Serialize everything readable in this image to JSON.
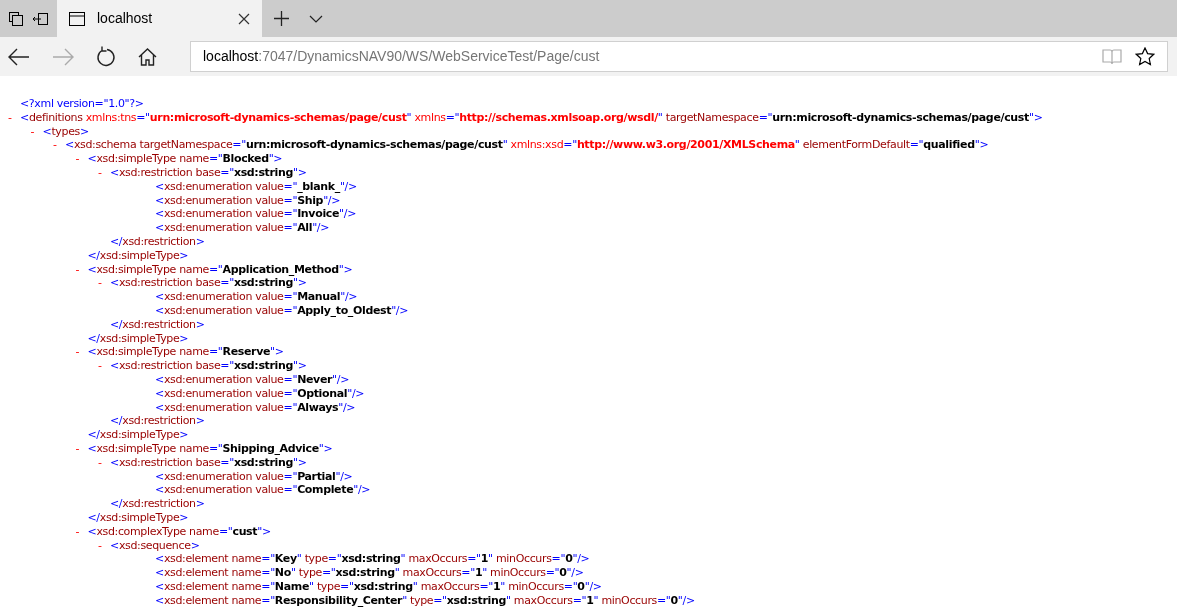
{
  "tab": {
    "title": "localhost",
    "selected": true
  },
  "address": {
    "host": "localhost",
    "path": ":7047/DynamicsNAV90/WS/WebServiceTest/Page/cust"
  },
  "nav": {
    "back_disabled": false,
    "forward_disabled": true
  },
  "xml": [
    {
      "parts": [
        {
          "kind": "markup",
          "text": "<?xml version=\"1.0\"?>"
        }
      ]
    },
    {
      "toggle": "-",
      "parts": [
        {
          "kind": "markup",
          "text": "<"
        },
        {
          "kind": "name",
          "text": "definitions"
        },
        {
          "kind": "nsname",
          "text": " xmlns:tns"
        },
        {
          "kind": "markup",
          "text": "=\""
        },
        {
          "kind": "nsvalue",
          "text": "urn:microsoft-dynamics-schemas/page/cust"
        },
        {
          "kind": "markup",
          "text": "\""
        },
        {
          "kind": "nsname",
          "text": " xmlns"
        },
        {
          "kind": "markup",
          "text": "=\""
        },
        {
          "kind": "nsvalue",
          "text": "http://schemas.xmlsoap.org/wsdl/"
        },
        {
          "kind": "markup",
          "text": "\""
        },
        {
          "kind": "name",
          "text": " targetNamespace"
        },
        {
          "kind": "markup",
          "text": "=\""
        },
        {
          "kind": "value",
          "text": "urn:microsoft-dynamics-schemas/page/cust"
        },
        {
          "kind": "markup",
          "text": "\">"
        }
      ],
      "children": [
        {
          "toggle": "-",
          "parts": [
            {
              "kind": "markup",
              "text": "<"
            },
            {
              "kind": "name",
              "text": "types"
            },
            {
              "kind": "markup",
              "text": ">"
            }
          ],
          "children": [
            {
              "toggle": "-",
              "parts": [
                {
                  "kind": "markup",
                  "text": "<"
                },
                {
                  "kind": "name",
                  "text": "xsd:schema"
                },
                {
                  "kind": "name",
                  "text": " targetNamespace"
                },
                {
                  "kind": "markup",
                  "text": "=\""
                },
                {
                  "kind": "value",
                  "text": "urn:microsoft-dynamics-schemas/page/cust"
                },
                {
                  "kind": "markup",
                  "text": "\""
                },
                {
                  "kind": "nsname",
                  "text": " xmlns:xsd"
                },
                {
                  "kind": "markup",
                  "text": "=\""
                },
                {
                  "kind": "nsvalue",
                  "text": "http://www.w3.org/2001/XMLSchema"
                },
                {
                  "kind": "markup",
                  "text": "\""
                },
                {
                  "kind": "name",
                  "text": " elementFormDefault"
                },
                {
                  "kind": "markup",
                  "text": "=\""
                },
                {
                  "kind": "value",
                  "text": "qualified"
                },
                {
                  "kind": "markup",
                  "text": "\">"
                }
              ],
              "children": [
                {
                  "toggle": "-",
                  "parts": [
                    {
                      "kind": "markup",
                      "text": "<"
                    },
                    {
                      "kind": "name",
                      "text": "xsd:simpleType"
                    },
                    {
                      "kind": "name",
                      "text": " name"
                    },
                    {
                      "kind": "markup",
                      "text": "=\""
                    },
                    {
                      "kind": "value",
                      "text": "Blocked"
                    },
                    {
                      "kind": "markup",
                      "text": "\">"
                    }
                  ],
                  "children": [
                    {
                      "toggle": "-",
                      "parts": [
                        {
                          "kind": "markup",
                          "text": "<"
                        },
                        {
                          "kind": "name",
                          "text": "xsd:restriction"
                        },
                        {
                          "kind": "name",
                          "text": " base"
                        },
                        {
                          "kind": "markup",
                          "text": "=\""
                        },
                        {
                          "kind": "value",
                          "text": "xsd:string"
                        },
                        {
                          "kind": "markup",
                          "text": "\">"
                        }
                      ],
                      "children": [
                        {
                          "parts": [
                            {
                              "kind": "markup",
                              "text": "<"
                            },
                            {
                              "kind": "name",
                              "text": "xsd:enumeration"
                            },
                            {
                              "kind": "name",
                              "text": " value"
                            },
                            {
                              "kind": "markup",
                              "text": "=\""
                            },
                            {
                              "kind": "value",
                              "text": "_blank_"
                            },
                            {
                              "kind": "markup",
                              "text": "\"/>"
                            }
                          ]
                        },
                        {
                          "parts": [
                            {
                              "kind": "markup",
                              "text": "<"
                            },
                            {
                              "kind": "name",
                              "text": "xsd:enumeration"
                            },
                            {
                              "kind": "name",
                              "text": " value"
                            },
                            {
                              "kind": "markup",
                              "text": "=\""
                            },
                            {
                              "kind": "value",
                              "text": "Ship"
                            },
                            {
                              "kind": "markup",
                              "text": "\"/>"
                            }
                          ]
                        },
                        {
                          "parts": [
                            {
                              "kind": "markup",
                              "text": "<"
                            },
                            {
                              "kind": "name",
                              "text": "xsd:enumeration"
                            },
                            {
                              "kind": "name",
                              "text": " value"
                            },
                            {
                              "kind": "markup",
                              "text": "=\""
                            },
                            {
                              "kind": "value",
                              "text": "Invoice"
                            },
                            {
                              "kind": "markup",
                              "text": "\"/>"
                            }
                          ]
                        },
                        {
                          "parts": [
                            {
                              "kind": "markup",
                              "text": "<"
                            },
                            {
                              "kind": "name",
                              "text": "xsd:enumeration"
                            },
                            {
                              "kind": "name",
                              "text": " value"
                            },
                            {
                              "kind": "markup",
                              "text": "=\""
                            },
                            {
                              "kind": "value",
                              "text": "All"
                            },
                            {
                              "kind": "markup",
                              "text": "\"/>"
                            }
                          ]
                        }
                      ],
                      "close": [
                        {
                          "kind": "markup",
                          "text": "</"
                        },
                        {
                          "kind": "name",
                          "text": "xsd:restriction"
                        },
                        {
                          "kind": "markup",
                          "text": ">"
                        }
                      ]
                    }
                  ],
                  "close": [
                    {
                      "kind": "markup",
                      "text": "</"
                    },
                    {
                      "kind": "name",
                      "text": "xsd:simpleType"
                    },
                    {
                      "kind": "markup",
                      "text": ">"
                    }
                  ]
                },
                {
                  "toggle": "-",
                  "parts": [
                    {
                      "kind": "markup",
                      "text": "<"
                    },
                    {
                      "kind": "name",
                      "text": "xsd:simpleType"
                    },
                    {
                      "kind": "name",
                      "text": " name"
                    },
                    {
                      "kind": "markup",
                      "text": "=\""
                    },
                    {
                      "kind": "value",
                      "text": "Application_Method"
                    },
                    {
                      "kind": "markup",
                      "text": "\">"
                    }
                  ],
                  "children": [
                    {
                      "toggle": "-",
                      "parts": [
                        {
                          "kind": "markup",
                          "text": "<"
                        },
                        {
                          "kind": "name",
                          "text": "xsd:restriction"
                        },
                        {
                          "kind": "name",
                          "text": " base"
                        },
                        {
                          "kind": "markup",
                          "text": "=\""
                        },
                        {
                          "kind": "value",
                          "text": "xsd:string"
                        },
                        {
                          "kind": "markup",
                          "text": "\">"
                        }
                      ],
                      "children": [
                        {
                          "parts": [
                            {
                              "kind": "markup",
                              "text": "<"
                            },
                            {
                              "kind": "name",
                              "text": "xsd:enumeration"
                            },
                            {
                              "kind": "name",
                              "text": " value"
                            },
                            {
                              "kind": "markup",
                              "text": "=\""
                            },
                            {
                              "kind": "value",
                              "text": "Manual"
                            },
                            {
                              "kind": "markup",
                              "text": "\"/>"
                            }
                          ]
                        },
                        {
                          "parts": [
                            {
                              "kind": "markup",
                              "text": "<"
                            },
                            {
                              "kind": "name",
                              "text": "xsd:enumeration"
                            },
                            {
                              "kind": "name",
                              "text": " value"
                            },
                            {
                              "kind": "markup",
                              "text": "=\""
                            },
                            {
                              "kind": "value",
                              "text": "Apply_to_Oldest"
                            },
                            {
                              "kind": "markup",
                              "text": "\"/>"
                            }
                          ]
                        }
                      ],
                      "close": [
                        {
                          "kind": "markup",
                          "text": "</"
                        },
                        {
                          "kind": "name",
                          "text": "xsd:restriction"
                        },
                        {
                          "kind": "markup",
                          "text": ">"
                        }
                      ]
                    }
                  ],
                  "close": [
                    {
                      "kind": "markup",
                      "text": "</"
                    },
                    {
                      "kind": "name",
                      "text": "xsd:simpleType"
                    },
                    {
                      "kind": "markup",
                      "text": ">"
                    }
                  ]
                },
                {
                  "toggle": "-",
                  "parts": [
                    {
                      "kind": "markup",
                      "text": "<"
                    },
                    {
                      "kind": "name",
                      "text": "xsd:simpleType"
                    },
                    {
                      "kind": "name",
                      "text": " name"
                    },
                    {
                      "kind": "markup",
                      "text": "=\""
                    },
                    {
                      "kind": "value",
                      "text": "Reserve"
                    },
                    {
                      "kind": "markup",
                      "text": "\">"
                    }
                  ],
                  "children": [
                    {
                      "toggle": "-",
                      "parts": [
                        {
                          "kind": "markup",
                          "text": "<"
                        },
                        {
                          "kind": "name",
                          "text": "xsd:restriction"
                        },
                        {
                          "kind": "name",
                          "text": " base"
                        },
                        {
                          "kind": "markup",
                          "text": "=\""
                        },
                        {
                          "kind": "value",
                          "text": "xsd:string"
                        },
                        {
                          "kind": "markup",
                          "text": "\">"
                        }
                      ],
                      "children": [
                        {
                          "parts": [
                            {
                              "kind": "markup",
                              "text": "<"
                            },
                            {
                              "kind": "name",
                              "text": "xsd:enumeration"
                            },
                            {
                              "kind": "name",
                              "text": " value"
                            },
                            {
                              "kind": "markup",
                              "text": "=\""
                            },
                            {
                              "kind": "value",
                              "text": "Never"
                            },
                            {
                              "kind": "markup",
                              "text": "\"/>"
                            }
                          ]
                        },
                        {
                          "parts": [
                            {
                              "kind": "markup",
                              "text": "<"
                            },
                            {
                              "kind": "name",
                              "text": "xsd:enumeration"
                            },
                            {
                              "kind": "name",
                              "text": " value"
                            },
                            {
                              "kind": "markup",
                              "text": "=\""
                            },
                            {
                              "kind": "value",
                              "text": "Optional"
                            },
                            {
                              "kind": "markup",
                              "text": "\"/>"
                            }
                          ]
                        },
                        {
                          "parts": [
                            {
                              "kind": "markup",
                              "text": "<"
                            },
                            {
                              "kind": "name",
                              "text": "xsd:enumeration"
                            },
                            {
                              "kind": "name",
                              "text": " value"
                            },
                            {
                              "kind": "markup",
                              "text": "=\""
                            },
                            {
                              "kind": "value",
                              "text": "Always"
                            },
                            {
                              "kind": "markup",
                              "text": "\"/>"
                            }
                          ]
                        }
                      ],
                      "close": [
                        {
                          "kind": "markup",
                          "text": "</"
                        },
                        {
                          "kind": "name",
                          "text": "xsd:restriction"
                        },
                        {
                          "kind": "markup",
                          "text": ">"
                        }
                      ]
                    }
                  ],
                  "close": [
                    {
                      "kind": "markup",
                      "text": "</"
                    },
                    {
                      "kind": "name",
                      "text": "xsd:simpleType"
                    },
                    {
                      "kind": "markup",
                      "text": ">"
                    }
                  ]
                },
                {
                  "toggle": "-",
                  "parts": [
                    {
                      "kind": "markup",
                      "text": "<"
                    },
                    {
                      "kind": "name",
                      "text": "xsd:simpleType"
                    },
                    {
                      "kind": "name",
                      "text": " name"
                    },
                    {
                      "kind": "markup",
                      "text": "=\""
                    },
                    {
                      "kind": "value",
                      "text": "Shipping_Advice"
                    },
                    {
                      "kind": "markup",
                      "text": "\">"
                    }
                  ],
                  "children": [
                    {
                      "toggle": "-",
                      "parts": [
                        {
                          "kind": "markup",
                          "text": "<"
                        },
                        {
                          "kind": "name",
                          "text": "xsd:restriction"
                        },
                        {
                          "kind": "name",
                          "text": " base"
                        },
                        {
                          "kind": "markup",
                          "text": "=\""
                        },
                        {
                          "kind": "value",
                          "text": "xsd:string"
                        },
                        {
                          "kind": "markup",
                          "text": "\">"
                        }
                      ],
                      "children": [
                        {
                          "parts": [
                            {
                              "kind": "markup",
                              "text": "<"
                            },
                            {
                              "kind": "name",
                              "text": "xsd:enumeration"
                            },
                            {
                              "kind": "name",
                              "text": " value"
                            },
                            {
                              "kind": "markup",
                              "text": "=\""
                            },
                            {
                              "kind": "value",
                              "text": "Partial"
                            },
                            {
                              "kind": "markup",
                              "text": "\"/>"
                            }
                          ]
                        },
                        {
                          "parts": [
                            {
                              "kind": "markup",
                              "text": "<"
                            },
                            {
                              "kind": "name",
                              "text": "xsd:enumeration"
                            },
                            {
                              "kind": "name",
                              "text": " value"
                            },
                            {
                              "kind": "markup",
                              "text": "=\""
                            },
                            {
                              "kind": "value",
                              "text": "Complete"
                            },
                            {
                              "kind": "markup",
                              "text": "\"/>"
                            }
                          ]
                        }
                      ],
                      "close": [
                        {
                          "kind": "markup",
                          "text": "</"
                        },
                        {
                          "kind": "name",
                          "text": "xsd:restriction"
                        },
                        {
                          "kind": "markup",
                          "text": ">"
                        }
                      ]
                    }
                  ],
                  "close": [
                    {
                      "kind": "markup",
                      "text": "</"
                    },
                    {
                      "kind": "name",
                      "text": "xsd:simpleType"
                    },
                    {
                      "kind": "markup",
                      "text": ">"
                    }
                  ]
                },
                {
                  "toggle": "-",
                  "parts": [
                    {
                      "kind": "markup",
                      "text": "<"
                    },
                    {
                      "kind": "name",
                      "text": "xsd:complexType"
                    },
                    {
                      "kind": "name",
                      "text": " name"
                    },
                    {
                      "kind": "markup",
                      "text": "=\""
                    },
                    {
                      "kind": "value",
                      "text": "cust"
                    },
                    {
                      "kind": "markup",
                      "text": "\">"
                    }
                  ],
                  "children": [
                    {
                      "toggle": "-",
                      "parts": [
                        {
                          "kind": "markup",
                          "text": "<"
                        },
                        {
                          "kind": "name",
                          "text": "xsd:sequence"
                        },
                        {
                          "kind": "markup",
                          "text": ">"
                        }
                      ],
                      "children": [
                        {
                          "parts": [
                            {
                              "kind": "markup",
                              "text": "<"
                            },
                            {
                              "kind": "name",
                              "text": "xsd:element"
                            },
                            {
                              "kind": "name",
                              "text": " name"
                            },
                            {
                              "kind": "markup",
                              "text": "=\""
                            },
                            {
                              "kind": "value",
                              "text": "Key"
                            },
                            {
                              "kind": "markup",
                              "text": "\""
                            },
                            {
                              "kind": "name",
                              "text": " type"
                            },
                            {
                              "kind": "markup",
                              "text": "=\""
                            },
                            {
                              "kind": "value",
                              "text": "xsd:string"
                            },
                            {
                              "kind": "markup",
                              "text": "\""
                            },
                            {
                              "kind": "name",
                              "text": " maxOccurs"
                            },
                            {
                              "kind": "markup",
                              "text": "=\""
                            },
                            {
                              "kind": "value",
                              "text": "1"
                            },
                            {
                              "kind": "markup",
                              "text": "\""
                            },
                            {
                              "kind": "name",
                              "text": " minOccurs"
                            },
                            {
                              "kind": "markup",
                              "text": "=\""
                            },
                            {
                              "kind": "value",
                              "text": "0"
                            },
                            {
                              "kind": "markup",
                              "text": "\"/>"
                            }
                          ]
                        },
                        {
                          "parts": [
                            {
                              "kind": "markup",
                              "text": "<"
                            },
                            {
                              "kind": "name",
                              "text": "xsd:element"
                            },
                            {
                              "kind": "name",
                              "text": " name"
                            },
                            {
                              "kind": "markup",
                              "text": "=\""
                            },
                            {
                              "kind": "value",
                              "text": "No"
                            },
                            {
                              "kind": "markup",
                              "text": "\""
                            },
                            {
                              "kind": "name",
                              "text": " type"
                            },
                            {
                              "kind": "markup",
                              "text": "=\""
                            },
                            {
                              "kind": "value",
                              "text": "xsd:string"
                            },
                            {
                              "kind": "markup",
                              "text": "\""
                            },
                            {
                              "kind": "name",
                              "text": " maxOccurs"
                            },
                            {
                              "kind": "markup",
                              "text": "=\""
                            },
                            {
                              "kind": "value",
                              "text": "1"
                            },
                            {
                              "kind": "markup",
                              "text": "\""
                            },
                            {
                              "kind": "name",
                              "text": " minOccurs"
                            },
                            {
                              "kind": "markup",
                              "text": "=\""
                            },
                            {
                              "kind": "value",
                              "text": "0"
                            },
                            {
                              "kind": "markup",
                              "text": "\"/>"
                            }
                          ]
                        },
                        {
                          "parts": [
                            {
                              "kind": "markup",
                              "text": "<"
                            },
                            {
                              "kind": "name",
                              "text": "xsd:element"
                            },
                            {
                              "kind": "name",
                              "text": " name"
                            },
                            {
                              "kind": "markup",
                              "text": "=\""
                            },
                            {
                              "kind": "value",
                              "text": "Name"
                            },
                            {
                              "kind": "markup",
                              "text": "\""
                            },
                            {
                              "kind": "name",
                              "text": " type"
                            },
                            {
                              "kind": "markup",
                              "text": "=\""
                            },
                            {
                              "kind": "value",
                              "text": "xsd:string"
                            },
                            {
                              "kind": "markup",
                              "text": "\""
                            },
                            {
                              "kind": "name",
                              "text": " maxOccurs"
                            },
                            {
                              "kind": "markup",
                              "text": "=\""
                            },
                            {
                              "kind": "value",
                              "text": "1"
                            },
                            {
                              "kind": "markup",
                              "text": "\""
                            },
                            {
                              "kind": "name",
                              "text": " minOccurs"
                            },
                            {
                              "kind": "markup",
                              "text": "=\""
                            },
                            {
                              "kind": "value",
                              "text": "0"
                            },
                            {
                              "kind": "markup",
                              "text": "\"/>"
                            }
                          ]
                        },
                        {
                          "parts": [
                            {
                              "kind": "markup",
                              "text": "<"
                            },
                            {
                              "kind": "name",
                              "text": "xsd:element"
                            },
                            {
                              "kind": "name",
                              "text": " name"
                            },
                            {
                              "kind": "markup",
                              "text": "=\""
                            },
                            {
                              "kind": "value",
                              "text": "Responsibility_Center"
                            },
                            {
                              "kind": "markup",
                              "text": "\""
                            },
                            {
                              "kind": "name",
                              "text": " type"
                            },
                            {
                              "kind": "markup",
                              "text": "=\""
                            },
                            {
                              "kind": "value",
                              "text": "xsd:string"
                            },
                            {
                              "kind": "markup",
                              "text": "\""
                            },
                            {
                              "kind": "name",
                              "text": " maxOccurs"
                            },
                            {
                              "kind": "markup",
                              "text": "=\""
                            },
                            {
                              "kind": "value",
                              "text": "1"
                            },
                            {
                              "kind": "markup",
                              "text": "\""
                            },
                            {
                              "kind": "name",
                              "text": " minOccurs"
                            },
                            {
                              "kind": "markup",
                              "text": "=\""
                            },
                            {
                              "kind": "value",
                              "text": "0"
                            },
                            {
                              "kind": "markup",
                              "text": "\"/>"
                            }
                          ]
                        }
                      ]
                    }
                  ]
                }
              ]
            }
          ]
        }
      ]
    }
  ]
}
